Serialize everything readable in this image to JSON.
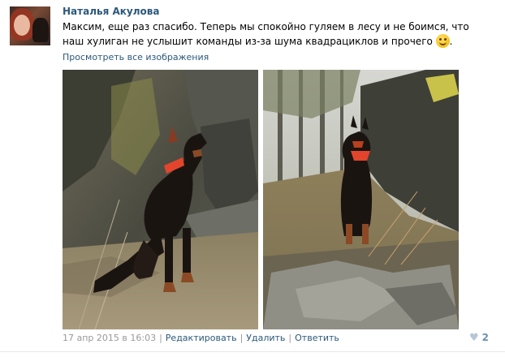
{
  "post": {
    "author": "Наталья Акулова",
    "text": "Максим, еще раз спасибо. Теперь мы спокойно гуляем в лесу и не боимся, что наш хулиган не услышит команды из-за шума квадрациклов и прочего",
    "emoji": "smile-emoji",
    "view_all_images": "Просмотреть все изображения",
    "footer": {
      "date": "17 апр 2015 в 16:03",
      "edit": "Редактировать",
      "delete": "Удалить",
      "reply": "Ответить",
      "separator": "|"
    },
    "likes": {
      "icon": "heart-icon",
      "count": "2"
    }
  },
  "colors": {
    "link": "#2b587a",
    "meta": "#999999",
    "likes": "#6d8fb3"
  }
}
